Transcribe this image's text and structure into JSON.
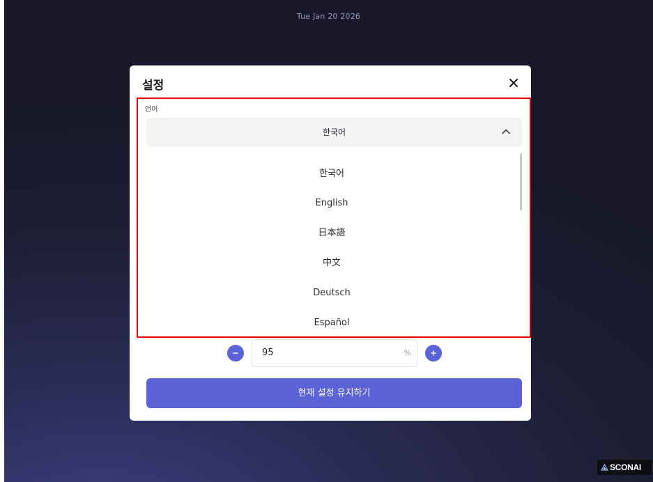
{
  "screen": {
    "date": "Tue Jan 20 2026"
  },
  "dialog": {
    "title": "설정",
    "close_icon": "close-icon",
    "language": {
      "label": "언어",
      "selected": "한국어",
      "expanded": true,
      "options": [
        "한국어",
        "English",
        "日本語",
        "中文",
        "Deutsch",
        "Español"
      ]
    },
    "zoom": {
      "value": "95",
      "unit": "%",
      "decrease_icon": "minus-icon",
      "increase_icon": "plus-icon"
    },
    "keep_button": "현재 설정 유지하기"
  },
  "brand": {
    "text": "SCONAI",
    "logo": "triangle-logo-icon"
  },
  "colors": {
    "accent": "#5c63d6",
    "highlight": "#e50000",
    "background": "#1d1d33"
  }
}
